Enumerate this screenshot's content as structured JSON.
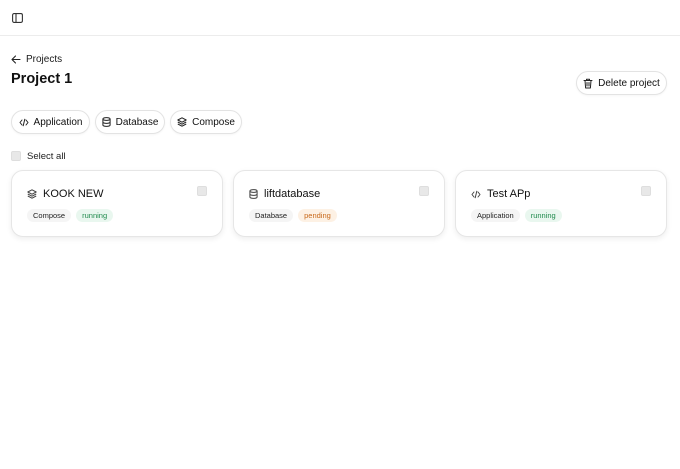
{
  "back_link": {
    "label": "Projects"
  },
  "project": {
    "title": "Project 1"
  },
  "actions": {
    "delete_label": "Delete project"
  },
  "add_buttons": [
    {
      "label": "Application",
      "icon": "code-icon"
    },
    {
      "label": "Database",
      "icon": "database-icon"
    },
    {
      "label": "Compose",
      "icon": "layers-icon"
    }
  ],
  "select_all": {
    "label": "Select all"
  },
  "services": [
    {
      "name": "KOOK NEW",
      "type": "Compose",
      "status": "running",
      "icon": "layers-icon"
    },
    {
      "name": "liftdatabase",
      "type": "Database",
      "status": "pending",
      "icon": "database-icon"
    },
    {
      "name": "Test APp",
      "type": "Application",
      "status": "running",
      "icon": "code-icon"
    }
  ],
  "colors": {
    "running": "#1f8a4c",
    "pending": "#c8681a",
    "border": "#e6e6e6"
  }
}
